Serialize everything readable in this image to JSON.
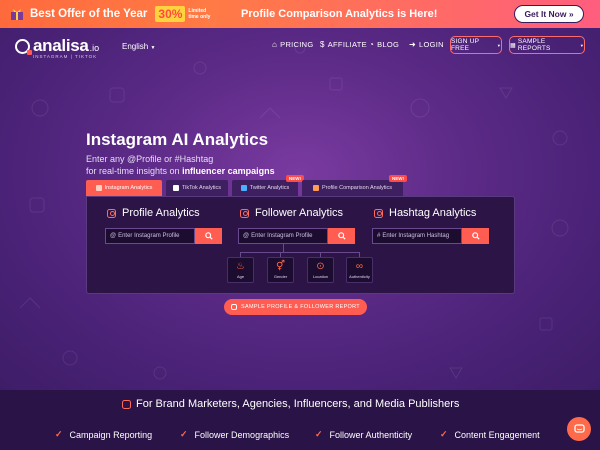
{
  "promo": {
    "best_offer": "Best Offer of the Year",
    "discount": "30%",
    "limited_time": "Limited time only",
    "announcement": "Profile Comparison Analytics is Here!",
    "cta": "Get It Now »"
  },
  "nav": {
    "logo": "analisa",
    "logo_tld": ".io",
    "logo_tagline": "INSTAGRAM | TIKTOK",
    "language": "English",
    "pricing": "PRICING",
    "affiliate": "AFFILIATE",
    "blog": "BLOG",
    "login": "LOGIN",
    "signup": "SIGN UP FREE",
    "sample_reports": "SAMPLE REPORTS"
  },
  "hero": {
    "title": "Instagram AI Analytics",
    "subtitle_line1": "Enter any @Profile or #Hashtag",
    "subtitle_line2_prefix": "for real-time insights on",
    "subtitle_line2_bold": "influencer campaigns"
  },
  "tabs": [
    {
      "label": "Instagram Analytics",
      "active": true
    },
    {
      "label": "TikTok Analytics",
      "active": false
    },
    {
      "label": "Twitter Analytics",
      "active": false,
      "badge": "NEW!"
    },
    {
      "label": "Profile Comparison Analytics",
      "active": false,
      "badge": "NEW!"
    }
  ],
  "columns": {
    "profile": {
      "title": "Profile Analytics",
      "placeholder": "Enter Instagram Profile"
    },
    "follower": {
      "title": "Follower Analytics",
      "placeholder": "Enter Instagram Profile"
    },
    "hashtag": {
      "title": "Hashtag Analytics",
      "placeholder": "Enter Instagram Hashtag"
    }
  },
  "follower_features": [
    {
      "label": "Age",
      "icon": "cake-icon"
    },
    {
      "label": "Gender",
      "icon": "gender-icon"
    },
    {
      "label": "Location",
      "icon": "location-pin-icon"
    },
    {
      "label": "Authenticity",
      "icon": "mask-icon"
    }
  ],
  "sample_button": "SAMPLE PROFILE & FOLLOWER REPORT",
  "bottom": {
    "title": "For Brand Marketers, Agencies, Influencers, and Media Publishers",
    "features": [
      "Campaign Reporting",
      "Follower Demographics",
      "Follower Authenticity",
      "Content Engagement"
    ]
  },
  "colors": {
    "accent": "#ff5c52",
    "purple_dark": "#2c1546",
    "purple_bg": "#5b2a86",
    "promo_yellow": "#ffd23f"
  }
}
